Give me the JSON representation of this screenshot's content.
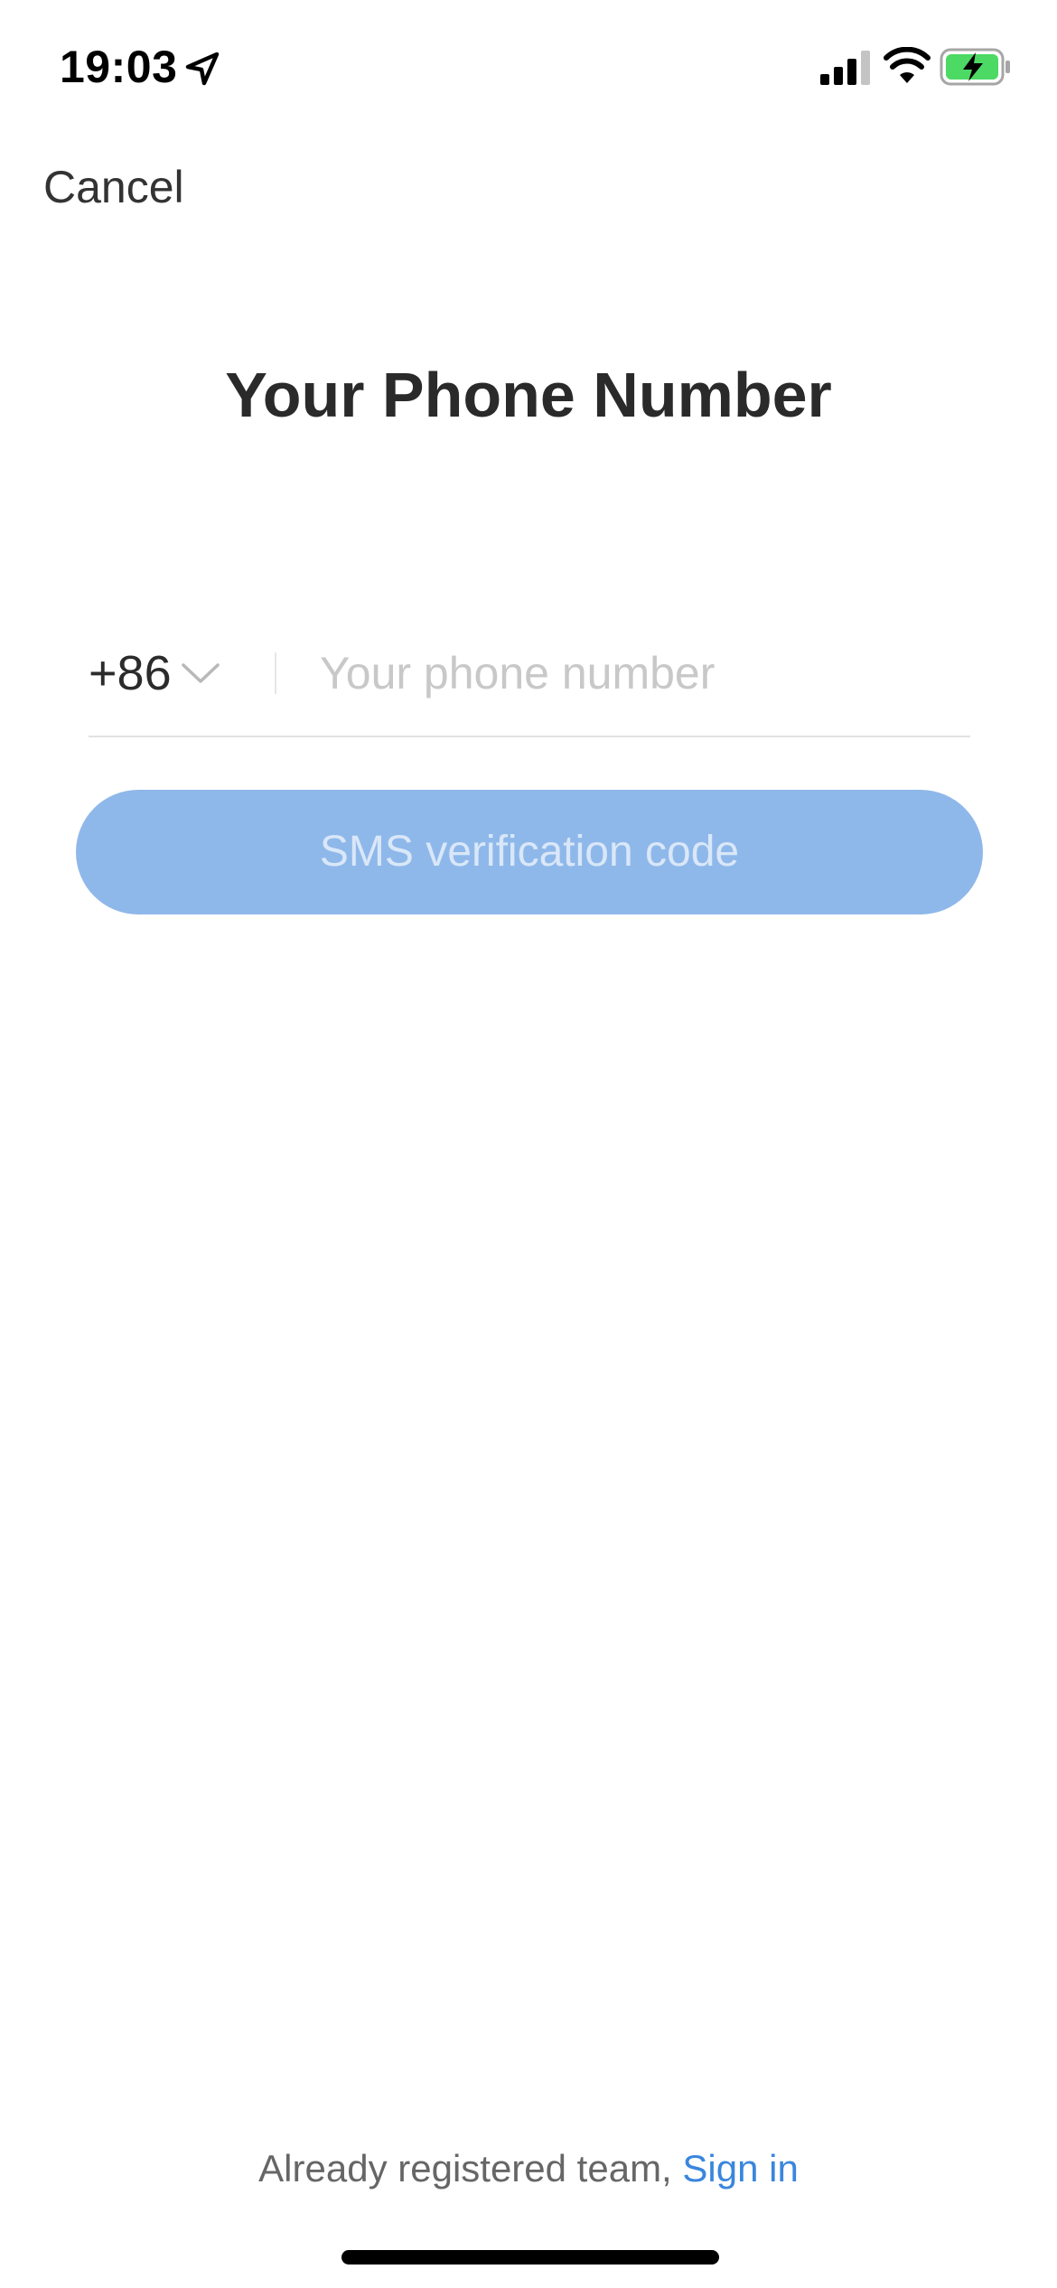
{
  "status_bar": {
    "time": "19:03",
    "battery_color": "#4cd964"
  },
  "header": {
    "cancel_label": "Cancel",
    "title": "Your Phone Number"
  },
  "form": {
    "country_code": "+86",
    "phone_placeholder": "Your phone number",
    "phone_value": "",
    "sms_button_label": "SMS verification code",
    "sms_button_color": "#8fb8ea"
  },
  "footer": {
    "text": "Already registered team,",
    "sign_in_label": "Sign in",
    "link_color": "#3a86dd"
  }
}
